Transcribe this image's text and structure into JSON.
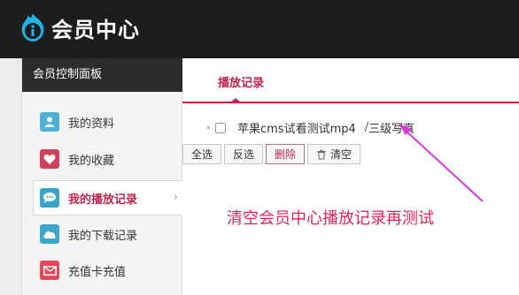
{
  "header": {
    "logo_icon": "info-flame-logo-icon",
    "title": "会员中心"
  },
  "sidebar": {
    "heading": "会员控制面板",
    "items": [
      {
        "label": "我的资料",
        "icon": "profile-icon",
        "color": "#4bb2d6"
      },
      {
        "label": "我的收藏",
        "icon": "heart-icon",
        "color": "#d2405c"
      },
      {
        "label": "我的播放记录",
        "icon": "chat-bubble-icon",
        "color": "#3aa6c9",
        "active": true
      },
      {
        "label": "我的下载记录",
        "icon": "cloud-icon",
        "color": "#3aa6c9"
      },
      {
        "label": "充值卡充值",
        "icon": "mail-icon",
        "color": "#e04a5a"
      }
    ],
    "active_arrow": "›"
  },
  "main": {
    "tab_label": "播放记录",
    "record": {
      "title": "苹果cms试看测试mp4",
      "separator": "/",
      "episode": "三级写真"
    },
    "buttons": {
      "select_all": "全选",
      "invert": "反选",
      "delete": "删除",
      "clear": "清空"
    },
    "annotation": "清空会员中心播放记录再测试"
  },
  "colors": {
    "accent": "#c0244d",
    "annotation": "#e0245a",
    "arrow": "#d63ad6"
  }
}
